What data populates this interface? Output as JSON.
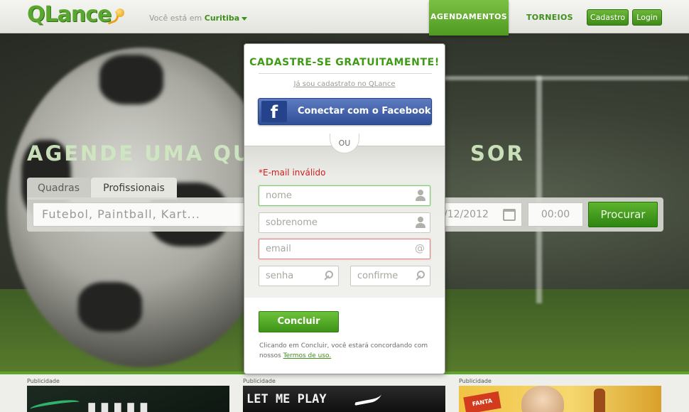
{
  "header": {
    "logo": "QLance",
    "location_prefix": "Você está em",
    "location_city": "Curitiba",
    "nav_active": "AGENDAMENTOS",
    "nav_link": "TORNEIOS",
    "signup_button": "Cadastro",
    "login_button": "Login"
  },
  "hero": {
    "title": "AGENDE UMA QUA",
    "title_tail": "SOR",
    "tabs": [
      "Quadras",
      "Profissionais"
    ],
    "search_placeholder": "Futebol, Paintball, Kart...",
    "date_value": "/12/2012",
    "time_value": "00:00",
    "search_button": "Procurar"
  },
  "modal": {
    "title": "CADASTRE-SE GRATUITAMENTE!",
    "login_link": "Já sou cadastrato no QLance",
    "facebook_icon": "f",
    "facebook_button": "Conectar com o Facebook",
    "divider": "OU",
    "error": "*E-mail inválido",
    "fields": {
      "first_name": "nome",
      "last_name": "sobrenome",
      "email": "email",
      "password": "senha",
      "confirm": "confirme"
    },
    "email_icon_glyph": "@",
    "submit_button": "Concluir",
    "terms_text": "Clicando em Concluir, você estará concordando com nossos",
    "terms_link": "Termos de uso."
  },
  "ads": {
    "label": "Publicidade",
    "ad2_text": "LET ME PLAY",
    "ad3_tag": "FANTA"
  },
  "colors": {
    "brand_green": "#3f9a16",
    "error_red": "#d02020",
    "facebook_blue": "#3b5998"
  }
}
